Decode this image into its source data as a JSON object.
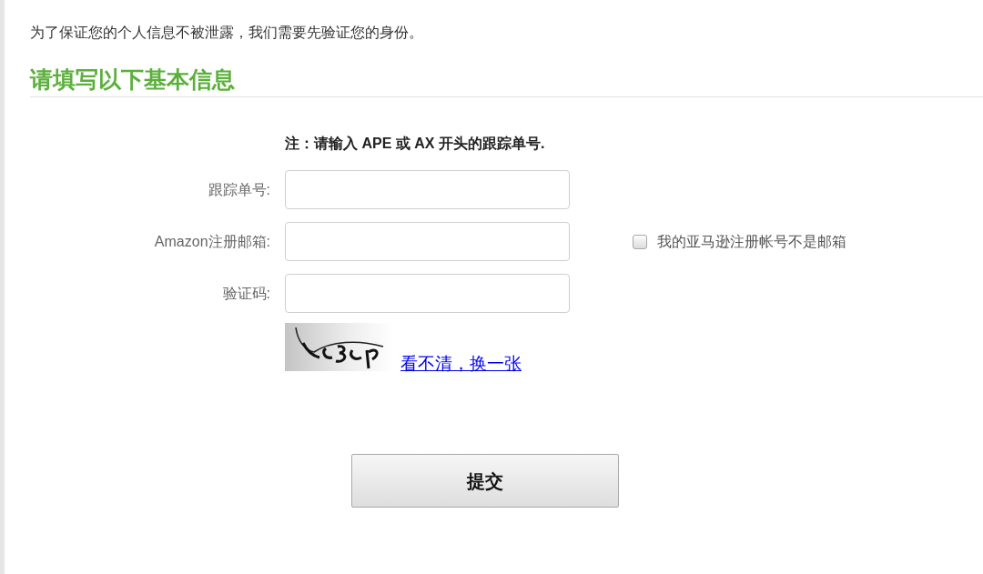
{
  "intro": "为了保证您的个人信息不被泄露，我们需要先验证您的身份。",
  "section_title": "请填写以下基本信息",
  "form": {
    "note": "注：请输入 APE 或 AX 开头的跟踪单号.",
    "fields": [
      {
        "label": "跟踪单号:"
      },
      {
        "label": "Amazon注册邮箱:",
        "checkbox": {
          "label": "我的亚马逊注册帐号不是邮箱",
          "checked": false
        }
      },
      {
        "label": "验证码:"
      }
    ],
    "captcha": {
      "refresh_link": "看不清，换一张"
    },
    "submit_button": "提交"
  }
}
